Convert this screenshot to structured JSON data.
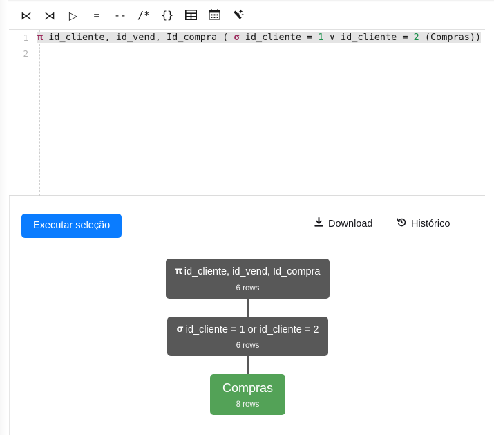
{
  "toolbar": {
    "buttons": [
      {
        "name": "left-semi-join-icon",
        "glyph": "⋉",
        "title": "Left semi join"
      },
      {
        "name": "right-semi-join-icon",
        "glyph": "⋊",
        "title": "Right semi join"
      },
      {
        "name": "projection-play-icon",
        "glyph": "▷",
        "title": "Execute"
      },
      {
        "name": "equals-icon",
        "glyph": "=",
        "title": "Equals"
      },
      {
        "name": "double-dash-icon",
        "glyph": "--",
        "title": "Line comment"
      },
      {
        "name": "block-comment-icon",
        "glyph": "/*",
        "title": "Block comment"
      },
      {
        "name": "braces-icon",
        "glyph": "{}",
        "title": "Braces"
      },
      {
        "name": "table-icon",
        "glyph": "▦",
        "title": "Insert table"
      },
      {
        "name": "calendar-icon",
        "glyph": "▤",
        "title": "Insert date"
      },
      {
        "name": "magic-wand-icon",
        "glyph": "✨",
        "title": "Format"
      }
    ]
  },
  "editor": {
    "lines": [
      {
        "number": "1"
      },
      {
        "number": "2"
      }
    ],
    "line1_tokens": [
      {
        "text": "π",
        "type": "op"
      },
      {
        "text": " id_cliente, id_vend, Id_compra ( ",
        "type": "plain"
      },
      {
        "text": "σ",
        "type": "op"
      },
      {
        "text": " id_cliente = ",
        "type": "plain"
      },
      {
        "text": "1",
        "type": "num"
      },
      {
        "text": " ∨ id_cliente = ",
        "type": "plain"
      },
      {
        "text": "2",
        "type": "num"
      },
      {
        "text": " (Compras))",
        "type": "plain"
      }
    ],
    "full_text": "π id_cliente, id_vend, Id_compra ( σ id_cliente = 1 ∨ id_cliente = 2 (Compras))"
  },
  "results": {
    "run_button_label": "Executar seleção",
    "download_label": "Download",
    "download_icon": "download-icon",
    "history_label": "Histórico",
    "history_icon": "history-icon"
  },
  "tree": {
    "nodes": [
      {
        "name": "projection-node",
        "kind": "operator",
        "symbol": "π",
        "title": "id_cliente, id_vend, Id_compra",
        "rows": "6 rows"
      },
      {
        "name": "selection-node",
        "kind": "operator",
        "symbol": "σ",
        "title": "id_cliente = 1 or id_cliente = 2",
        "rows": "6 rows"
      },
      {
        "name": "relation-node-compras",
        "kind": "relation",
        "symbol": "",
        "title": "Compras",
        "rows": "8 rows"
      }
    ]
  },
  "colors": {
    "accent_blue": "#0a7cff",
    "node_gray": "#585858",
    "relation_green": "#53a257",
    "operator_maroon": "#9c2a5c",
    "number_green": "#1a8f4a",
    "selection_highlight": "#e4e4e4"
  }
}
